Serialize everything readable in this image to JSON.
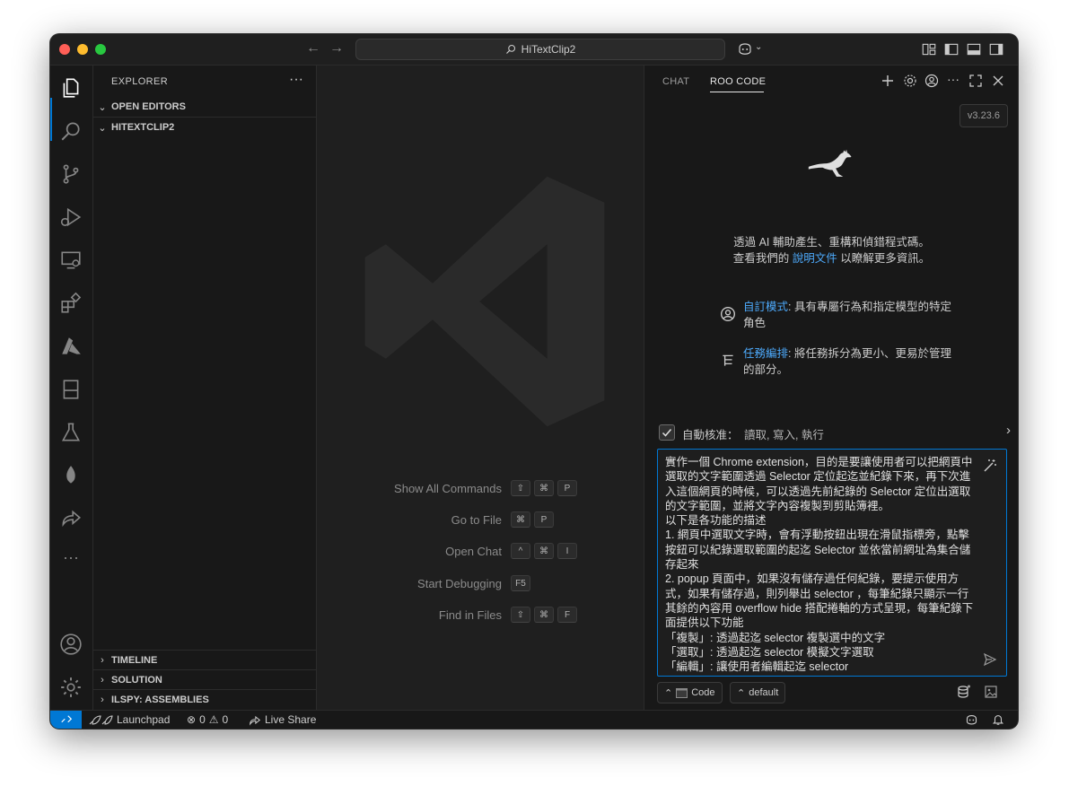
{
  "window": {
    "title": "HiTextClip2",
    "traffic_colors": {
      "close": "#ff5f57",
      "minimize": "#febc2e",
      "zoom": "#28c840"
    }
  },
  "sidebar": {
    "title": "EXPLORER",
    "more": "···",
    "sections": {
      "open_editors": "OPEN EDITORS",
      "workspace": "HITEXTCLIP2",
      "timeline": "TIMELINE",
      "solution": "SOLUTION",
      "ilspy": "ILSPY: ASSEMBLIES"
    }
  },
  "editor": {
    "shortcuts": [
      {
        "label": "Show All Commands",
        "keys": [
          "⇧",
          "⌘",
          "P"
        ]
      },
      {
        "label": "Go to File",
        "keys": [
          "⌘",
          "P"
        ]
      },
      {
        "label": "Open Chat",
        "keys": [
          "^",
          "⌘",
          "I"
        ]
      },
      {
        "label": "Start Debugging",
        "keys": [
          "F5"
        ]
      },
      {
        "label": "Find in Files",
        "keys": [
          "⇧",
          "⌘",
          "F"
        ]
      }
    ]
  },
  "panel": {
    "tabs": [
      "CHAT",
      "ROO CODE"
    ],
    "version": "v3.23.6",
    "intro_line1": "透過 AI 輔助產生、重構和偵錯程式碼。",
    "intro_line2_prefix": "查看我們的 ",
    "intro_link": "說明文件",
    "intro_line2_suffix": " 以瞭解更多資訊。",
    "features": [
      {
        "title": "自訂模式",
        "text": ": 具有專屬行為和指定模型的特定角色",
        "icon": "account-icon"
      },
      {
        "title": "任務編排",
        "text": ": 將任務拆分為更小、更易於管理的部分。",
        "icon": "list-tree-icon"
      }
    ],
    "auto_approve_label": "自動核准：",
    "auto_approve_values": "讀取, 寫入, 執行",
    "input_text": "實作一個 Chrome extension，目的是要讓使用者可以把網頁中選取的文字範圍透過 Selector 定位起迄並紀錄下來，再下次進入這個網頁的時候，可以透過先前紀錄的 Selector 定位出選取的文字範圍，並將文字內容複製到剪貼簿裡。\n以下是各功能的描述\n1. 網頁中選取文字時，會有浮動按鈕出現在滑鼠指標旁，點擊按鈕可以紀錄選取範圍的起迄 Selector 並依當前網址為集合儲存起來\n2. popup 頁面中，如果沒有儲存過任何紀錄，要提示使用方式，如果有儲存過，則列舉出 selector ，每筆紀錄只顯示一行其餘的內容用 overflow hide 搭配捲軸的方式呈現，每筆紀錄下面提供以下功能\n「複製」: 透過起迄 selector 複製選中的文字\n「選取」: 透過起迄 selector 模擬文字選取\n「編輯」: 讓使用者編輯起迄 selector",
    "mode_button": "Code",
    "config_button": "default"
  },
  "statusbar": {
    "launchpad": "Launchpad",
    "errors": "0",
    "warnings": "0",
    "live_share": "Live Share"
  },
  "colors": {
    "accent": "#0078d4",
    "link": "#4daafc"
  }
}
